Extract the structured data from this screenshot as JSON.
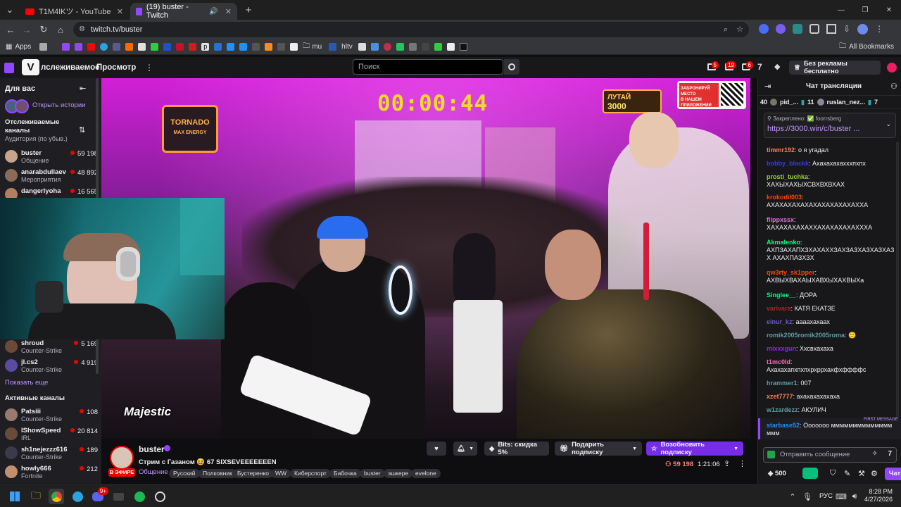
{
  "browser": {
    "tabs": [
      {
        "label": "T1M4IKツ - YouTube",
        "active": false
      },
      {
        "label": "(19) buster - Twitch",
        "active": true
      }
    ],
    "new_tab": "+",
    "url": "twitch.tv/buster",
    "window_controls": [
      "—",
      "❐",
      "✕"
    ],
    "bookmarks_apps": "Apps",
    "bookmarks": [
      "p",
      "mu",
      "hltv"
    ],
    "all_bookmarks": "All Bookmarks"
  },
  "twitch": {
    "nav": {
      "logo": "V",
      "following": "лслеживаемое",
      "browse": "Просмотр",
      "more": "⋮",
      "search_placeholder": "Поиск",
      "badges": [
        "5",
        "19",
        "6"
      ],
      "prime_label": "Без рекламы бесплатно"
    },
    "sidebar": {
      "for_you": "Для вас",
      "open_stories": "Открыть истории",
      "followed_channels": "Отслеживаемые каналы",
      "audience_sort": "Аудитория (по убыв.)",
      "followed": [
        {
          "name": "buster",
          "game": "Общение",
          "viewers": "59 198",
          "color": "#c8a48a"
        },
        {
          "name": "anarabdullaev",
          "game": "Мероприятия",
          "viewers": "48 892",
          "color": "#8a6b58"
        },
        {
          "name": "dangerlyoha",
          "game": "",
          "viewers": "16 565",
          "color": "#b08060"
        },
        {
          "name": "shroud",
          "game": "Counter-Strike",
          "viewers": "5 169",
          "color": "#6b4a3a"
        },
        {
          "name": "jl.cs2",
          "game": "Counter-Strike",
          "viewers": "4 919",
          "color": "#5a4aa0"
        }
      ],
      "show_more": "Показать еще",
      "active_channels": "Активные каналы",
      "active": [
        {
          "name": "Patsiii",
          "game": "Counter-Strike",
          "viewers": "108",
          "color": "#9a7a70"
        },
        {
          "name": "IShowSpeed",
          "game": "IRL",
          "viewers": "20 814",
          "color": "#6a4a3a"
        },
        {
          "name": "sh1nejezzz616",
          "game": "Counter-Strike",
          "viewers": "189",
          "color": "#3a3a4a"
        },
        {
          "name": "howly666",
          "game": "Fortnite",
          "viewers": "212",
          "color": "#c09070"
        }
      ]
    },
    "video": {
      "timer": "00:00:44",
      "promo_left_1": "ЛУТАЙ",
      "promo_left_2": "3000",
      "promo_right_1": "ЗАБРОНИРУЙ МЕСТО",
      "promo_right_2": "В НАШЕМ ПРИЛОЖЕНИИ",
      "sign_1": "TORNADO",
      "sign_2": "MAX ENERGY",
      "majestic": "Majestic"
    },
    "stream": {
      "channel": "buster",
      "title": "Стрим с Газаном 😆 67 SIXSEVEEEEEEEN",
      "category": "Общение",
      "live": "В ЭФИРЕ",
      "tags": [
        "Русский",
        "Полковник",
        "Бустеренко",
        "WW",
        "Киберспорт",
        "Бабочка",
        "buster",
        "эшкере",
        "evelone"
      ],
      "bits_label": "Bits: скидка 5%",
      "gift_label": "Подарить подписку",
      "resub_label": "Возобновить подписку",
      "viewers": "59 198",
      "uptime": "1:21:06"
    },
    "chat": {
      "header": "Чат трансляции",
      "leaderboard": [
        {
          "rank": "40",
          "name": "pid_..."
        },
        {
          "rank": "11",
          "name": "ruslan_nez..."
        },
        {
          "rank": "7",
          "name": ""
        }
      ],
      "pinned_label": "Закреплено: ✅ foorrsberg",
      "pinned_link": "https://3000.win/c/buster ...",
      "messages": [
        {
          "user": "timmr192",
          "text": "о я угадал",
          "color": "#ff7f50"
        },
        {
          "user": "bobby_blackk",
          "text": "Ахахахахахххпхпх",
          "color": "#3a3ad8"
        },
        {
          "user": "prosti_tuchka",
          "text": "ХАХЫХАХЫХСВХВХВХАХ",
          "color": "#9acd32"
        },
        {
          "user": "krokodil003",
          "text": "АХАХАХАХАХАХАХАХАХАХАХХА",
          "color": "#ff4500"
        },
        {
          "user": "flippxssx",
          "text": "ХАХАХАХАХАХХАХАХАХАХАХХХА",
          "color": "#da70d6"
        },
        {
          "user": "Akmalenko",
          "text": "АХПЗАХАПХЗХАХАХХЗАХЗАЗХАЗХАЗХАЗХ АХАХПАЗХЗХ",
          "color": "#00ff7f"
        },
        {
          "user": "qw3rty_sk1pper",
          "text": "АХВЫХВАХАЫХАВХЫХАХВЫХа",
          "color": "#ff4500"
        },
        {
          "user": "Singlee__",
          "text": "ДОРА",
          "color": "#00ff7f"
        },
        {
          "user": "varivara",
          "text": "КАТЯ ЕКАТЗЕ",
          "color": "#b22222"
        },
        {
          "user": "einur_kz",
          "text": "аааахахаах",
          "color": "#6a5acd"
        },
        {
          "user": "romik2005romik2005roma",
          "text": "🙂",
          "color": "#5f9ea0"
        },
        {
          "user": "mixxxgun",
          "text": "Ххсвхахаха",
          "color": "#8a2be2"
        },
        {
          "user": "t1mc0ld",
          "text": "Ахахахапхпхпхрхррхахфхффффс",
          "color": "#ff69b4"
        },
        {
          "user": "hrammer1",
          "text": "007",
          "color": "#5f9ea0"
        },
        {
          "user": "xzet7777",
          "text": "ахахахахахаха",
          "color": "#ff7f50"
        },
        {
          "user": "w1zardezz",
          "text": "АКУЛИЧ",
          "color": "#5f9ea0"
        },
        {
          "user": "starbase52",
          "text": "Ооооооо ммммммммммммммммм",
          "color": "#1e90ff"
        }
      ],
      "first_message": "FIRST MESSAGE",
      "input_placeholder": "Отправить сообщение",
      "points": "500",
      "chat_button": "Чат"
    }
  },
  "taskbar": {
    "lang": "РУС",
    "time": "8:28 PM",
    "date": "4/27/2026",
    "discord_badge": "9+"
  },
  "colors": {
    "twitch_purple": "#9147ff",
    "resub_purple": "#772ce8",
    "live_red": "#eb0400",
    "timer_yellow": "#f1d92b"
  }
}
